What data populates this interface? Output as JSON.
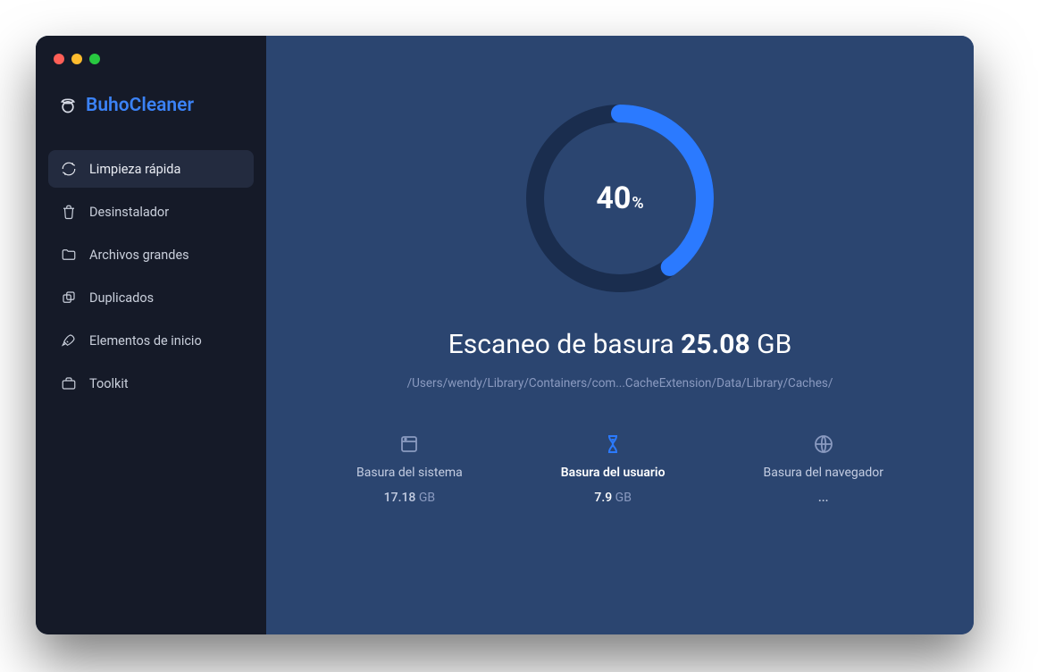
{
  "app": {
    "name": "BuhoCleaner"
  },
  "sidebar": {
    "items": [
      {
        "label": "Limpieza rápida",
        "active": true
      },
      {
        "label": "Desinstalador"
      },
      {
        "label": "Archivos grandes"
      },
      {
        "label": "Duplicados"
      },
      {
        "label": "Elementos de inicio"
      },
      {
        "label": "Toolkit"
      }
    ]
  },
  "scan": {
    "progress_percent": "40",
    "percent_symbol": "%",
    "title_prefix": "Escaneo de basura ",
    "size_value": "25.08",
    "size_unit": " GB",
    "current_path": "/Users/wendy/Library/Containers/com...CacheExtension/Data/Library/Caches/"
  },
  "categories": [
    {
      "label": "Basura del sistema",
      "value": "17.18",
      "unit": " GB",
      "active": false
    },
    {
      "label": "Basura del usuario",
      "value": "7.9",
      "unit": " GB",
      "active": true
    },
    {
      "label": "Basura del navegador",
      "value": "...",
      "unit": "",
      "active": false
    }
  ],
  "colors": {
    "accent": "#2b7aff",
    "sidebar_bg": "#151a28",
    "main_bg": "#2b4570"
  }
}
